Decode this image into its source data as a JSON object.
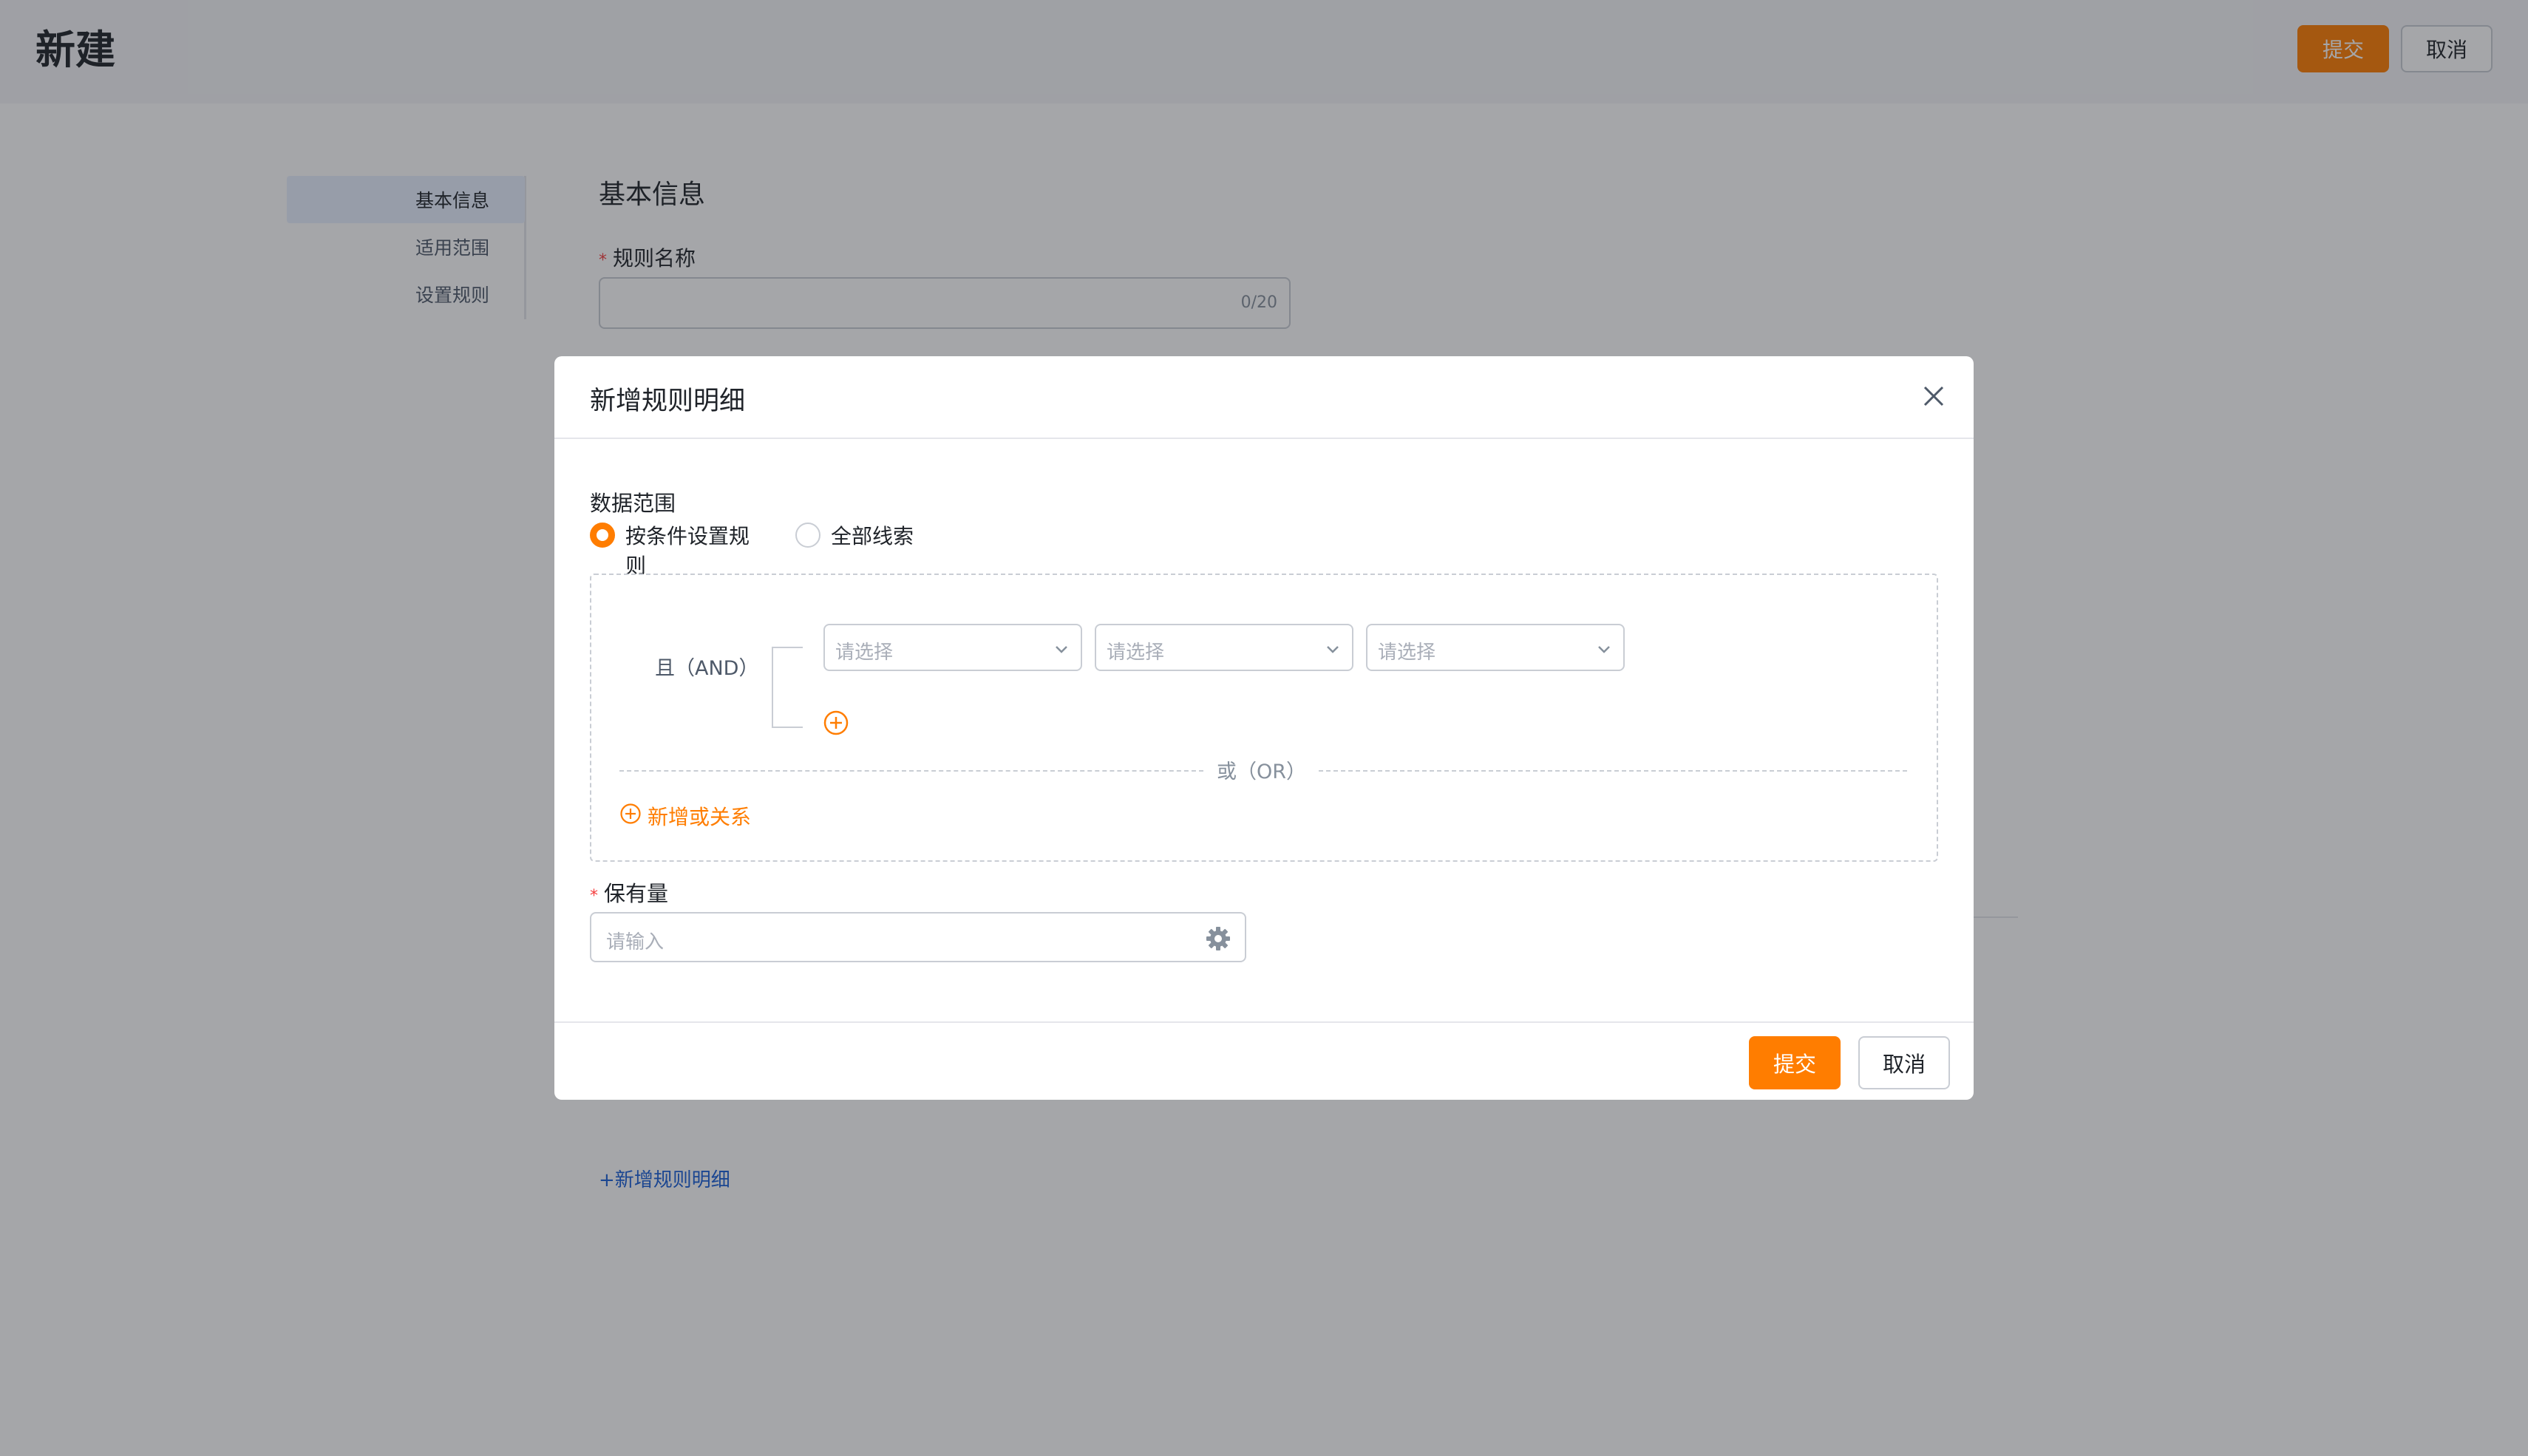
{
  "page": {
    "title": "新建",
    "submit_label": "提交",
    "cancel_label": "取消"
  },
  "side_nav": {
    "items": [
      {
        "label": "基本信息",
        "active": true
      },
      {
        "label": "适用范围",
        "active": false
      },
      {
        "label": "设置规则",
        "active": false
      }
    ]
  },
  "form": {
    "section_title": "基本信息",
    "rule_name_label": "规则名称",
    "rule_name_count": "0/20",
    "add_detail_link": "+新增规则明细"
  },
  "modal": {
    "title": "新增规则明细",
    "data_scope_label": "数据范围",
    "options": [
      {
        "label": "按条件设置规则",
        "checked": true
      },
      {
        "label": "全部线索",
        "checked": false
      }
    ],
    "and_label": "且（AND）",
    "selects": [
      {
        "placeholder": "请选择"
      },
      {
        "placeholder": "请选择"
      },
      {
        "placeholder": "请选择"
      }
    ],
    "or_label": "或（OR）",
    "add_or_label": "新增或关系",
    "holding_label": "保有量",
    "holding_placeholder": "请输入",
    "submit_label": "提交",
    "cancel_label": "取消"
  },
  "colors": {
    "accent": "#ff7d00",
    "link": "#1a5fd8",
    "mask": "rgba(29,33,41,0.40)",
    "required": "#f53f3f"
  }
}
